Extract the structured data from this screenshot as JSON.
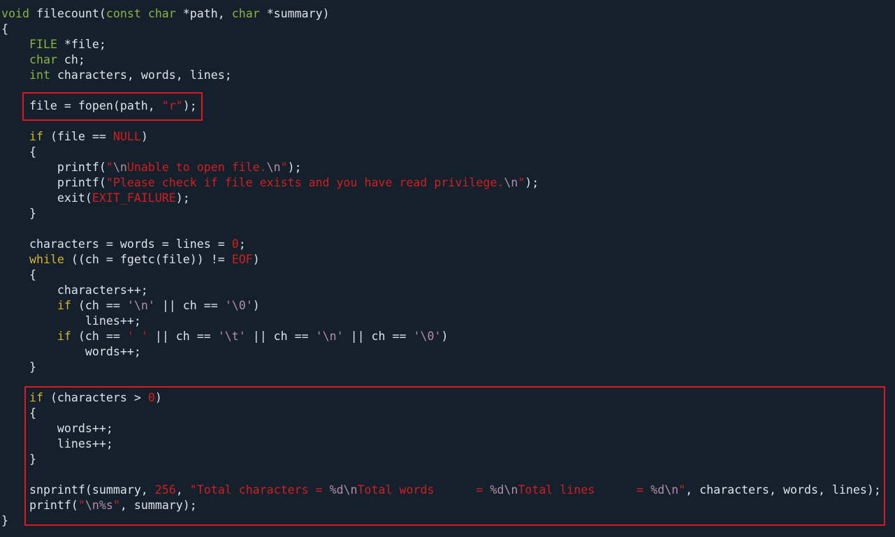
{
  "colors": {
    "background": "#15202d",
    "text": "#dde3ea",
    "type_keyword": "#8db33e",
    "control_keyword": "#d6b52a",
    "string_literal": "#d21e1e",
    "escape_sequence": "#b58ea3",
    "highlight_border": "#e0161a"
  },
  "code": {
    "lines": [
      [
        [
          "type",
          "void"
        ],
        [
          "plain",
          " filecount("
        ],
        [
          "type",
          "const"
        ],
        [
          "plain",
          " "
        ],
        [
          "type",
          "char"
        ],
        [
          "plain",
          " *path, "
        ],
        [
          "type",
          "char"
        ],
        [
          "plain",
          " *summary)"
        ]
      ],
      [
        [
          "plain",
          "{"
        ]
      ],
      [
        [
          "plain",
          "    "
        ],
        [
          "type",
          "FILE"
        ],
        [
          "plain",
          " *file;"
        ]
      ],
      [
        [
          "plain",
          "    "
        ],
        [
          "type",
          "char"
        ],
        [
          "plain",
          " ch;"
        ]
      ],
      [
        [
          "plain",
          "    "
        ],
        [
          "type",
          "int"
        ],
        [
          "plain",
          " characters, words, lines;"
        ]
      ],
      [],
      [
        [
          "plain",
          "    file = fopen(path, "
        ],
        [
          "str",
          "\"r\""
        ],
        [
          "plain",
          ");"
        ]
      ],
      [],
      [
        [
          "plain",
          "    "
        ],
        [
          "kw",
          "if"
        ],
        [
          "plain",
          " (file == "
        ],
        [
          "const",
          "NULL"
        ],
        [
          "plain",
          ")"
        ]
      ],
      [
        [
          "plain",
          "    {"
        ]
      ],
      [
        [
          "plain",
          "        printf("
        ],
        [
          "str",
          "\""
        ],
        [
          "esc",
          "\\n"
        ],
        [
          "str",
          "Unable to open file."
        ],
        [
          "esc",
          "\\n"
        ],
        [
          "str",
          "\""
        ],
        [
          "plain",
          ");"
        ]
      ],
      [
        [
          "plain",
          "        printf("
        ],
        [
          "str",
          "\"Please check if file exists and you have read privilege."
        ],
        [
          "esc",
          "\\n"
        ],
        [
          "str",
          "\""
        ],
        [
          "plain",
          ");"
        ]
      ],
      [
        [
          "plain",
          "        exit("
        ],
        [
          "const",
          "EXIT_FAILURE"
        ],
        [
          "plain",
          ");"
        ]
      ],
      [
        [
          "plain",
          "    }"
        ]
      ],
      [],
      [
        [
          "plain",
          "    characters = words = lines = "
        ],
        [
          "num",
          "0"
        ],
        [
          "plain",
          ";"
        ]
      ],
      [
        [
          "plain",
          "    "
        ],
        [
          "kw",
          "while"
        ],
        [
          "plain",
          " ((ch = fgetc(file)) != "
        ],
        [
          "const",
          "EOF"
        ],
        [
          "plain",
          ")"
        ]
      ],
      [
        [
          "plain",
          "    {"
        ]
      ],
      [
        [
          "plain",
          "        characters++;"
        ]
      ],
      [
        [
          "plain",
          "        "
        ],
        [
          "kw",
          "if"
        ],
        [
          "plain",
          " (ch == "
        ],
        [
          "esc",
          "'\\n'"
        ],
        [
          "plain",
          " || ch == "
        ],
        [
          "esc",
          "'\\0'"
        ],
        [
          "plain",
          ")"
        ]
      ],
      [
        [
          "plain",
          "            lines++;"
        ]
      ],
      [
        [
          "plain",
          "        "
        ],
        [
          "kw",
          "if"
        ],
        [
          "plain",
          " (ch == "
        ],
        [
          "str",
          "' '"
        ],
        [
          "plain",
          " || ch == "
        ],
        [
          "esc",
          "'\\t'"
        ],
        [
          "plain",
          " || ch == "
        ],
        [
          "esc",
          "'\\n'"
        ],
        [
          "plain",
          " || ch == "
        ],
        [
          "esc",
          "'\\0'"
        ],
        [
          "plain",
          ")"
        ]
      ],
      [
        [
          "plain",
          "            words++;"
        ]
      ],
      [
        [
          "plain",
          "    }"
        ]
      ],
      [],
      [
        [
          "plain",
          "    "
        ],
        [
          "kw",
          "if"
        ],
        [
          "plain",
          " (characters > "
        ],
        [
          "num",
          "0"
        ],
        [
          "plain",
          ")"
        ]
      ],
      [
        [
          "plain",
          "    {"
        ]
      ],
      [
        [
          "plain",
          "        words++;"
        ]
      ],
      [
        [
          "plain",
          "        lines++;"
        ]
      ],
      [
        [
          "plain",
          "    }"
        ]
      ],
      [],
      [
        [
          "plain",
          "    snprintf(summary, "
        ],
        [
          "num",
          "256"
        ],
        [
          "plain",
          ", "
        ],
        [
          "str",
          "\"Total characters = "
        ],
        [
          "esc",
          "%d\\n"
        ],
        [
          "str",
          "Total words      = "
        ],
        [
          "esc",
          "%d\\n"
        ],
        [
          "str",
          "Total lines      = "
        ],
        [
          "esc",
          "%d\\n"
        ],
        [
          "str",
          "\""
        ],
        [
          "plain",
          ", characters, words, lines);"
        ]
      ],
      [
        [
          "plain",
          "    printf("
        ],
        [
          "str",
          "\""
        ],
        [
          "esc",
          "\\n%s"
        ],
        [
          "str",
          "\""
        ],
        [
          "plain",
          ", summary);"
        ]
      ],
      [
        [
          "plain",
          "}"
        ]
      ]
    ]
  }
}
